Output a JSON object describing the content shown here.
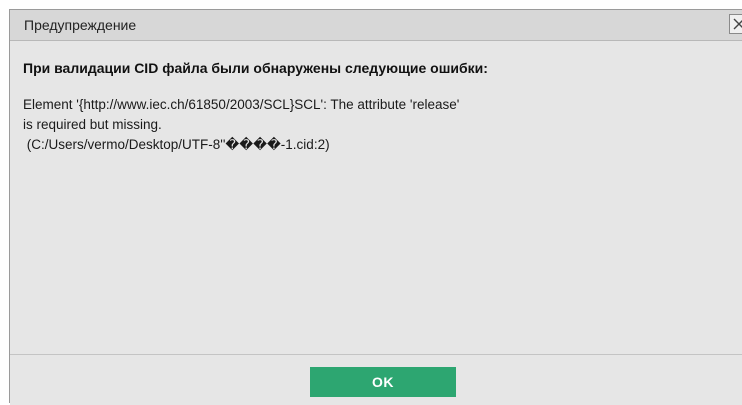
{
  "dialog": {
    "title": "Предупреждение",
    "close_icon": "close-icon",
    "heading": "При валидации CID файла были обнаружены следующие ошибки:",
    "message_lines": [
      "Element '{http://www.iec.ch/61850/2003/SCL}SCL': The attribute 'release'",
      "is required but missing.",
      " (C:/Users/vermo/Desktop/UTF-8''����-1.cid:2)"
    ],
    "ok_label": "OK"
  },
  "colors": {
    "ok_button": "#2da671",
    "dialog_background": "#e6e6e6"
  }
}
